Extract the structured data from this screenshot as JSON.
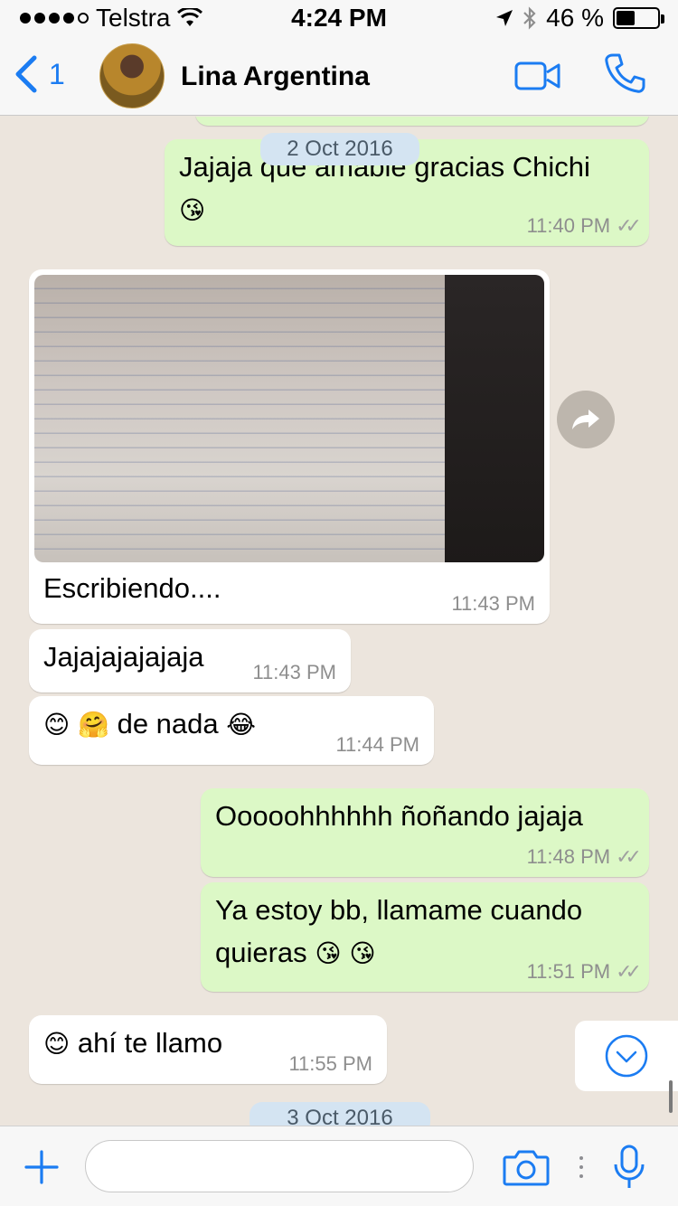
{
  "status_bar": {
    "carrier": "Telstra",
    "time": "4:24 PM",
    "battery": "46 %",
    "battery_level": 0.46,
    "icons": [
      "signal-dots",
      "wifi-icon",
      "location-arrow-icon",
      "bluetooth-icon",
      "battery-icon"
    ]
  },
  "header": {
    "back_count": "1",
    "contact_name": "Lina Argentina",
    "icons": [
      "back-chevron-icon",
      "video-call-icon",
      "phone-call-icon"
    ],
    "accent": "#1b7cf2"
  },
  "chat": {
    "date_1": "2 Oct 2016",
    "date_2": "3 Oct 2016",
    "messages": [
      {
        "dir": "out",
        "text": "Jajaja que amable gracias Chichi",
        "emoji": "😘",
        "time": "11:40 PM"
      },
      {
        "dir": "in",
        "type": "photo",
        "caption": "Escribiendo....",
        "time": "11:43 PM"
      },
      {
        "dir": "in",
        "text": "Jajajajajajaja",
        "time": "11:43 PM"
      },
      {
        "dir": "in",
        "emoji_pre": "😊 🤗",
        "text": "de nada",
        "emoji_post": "😂",
        "time": "11:44 PM"
      },
      {
        "dir": "out",
        "text": "Ooooohhhhhh ñoñando jajaja",
        "time": "11:48 PM"
      },
      {
        "dir": "out",
        "text_line1": "Ya estoy bb, llamame cuando",
        "text_line2": "quieras",
        "emoji": "😘 😘",
        "time": "11:51 PM"
      },
      {
        "dir": "in",
        "emoji_pre": "😊",
        "text": "ahí te llamo",
        "time": "11:55 PM"
      }
    ],
    "read_ticks": "✓✓"
  },
  "input_bar": {
    "message_value": "",
    "icons": [
      "plus-icon",
      "camera-icon",
      "microphone-icon"
    ]
  },
  "colors": {
    "outgoing_bubble": "#dcf8c6",
    "incoming_bubble": "#ffffff",
    "chat_background": "#ece5dd"
  }
}
